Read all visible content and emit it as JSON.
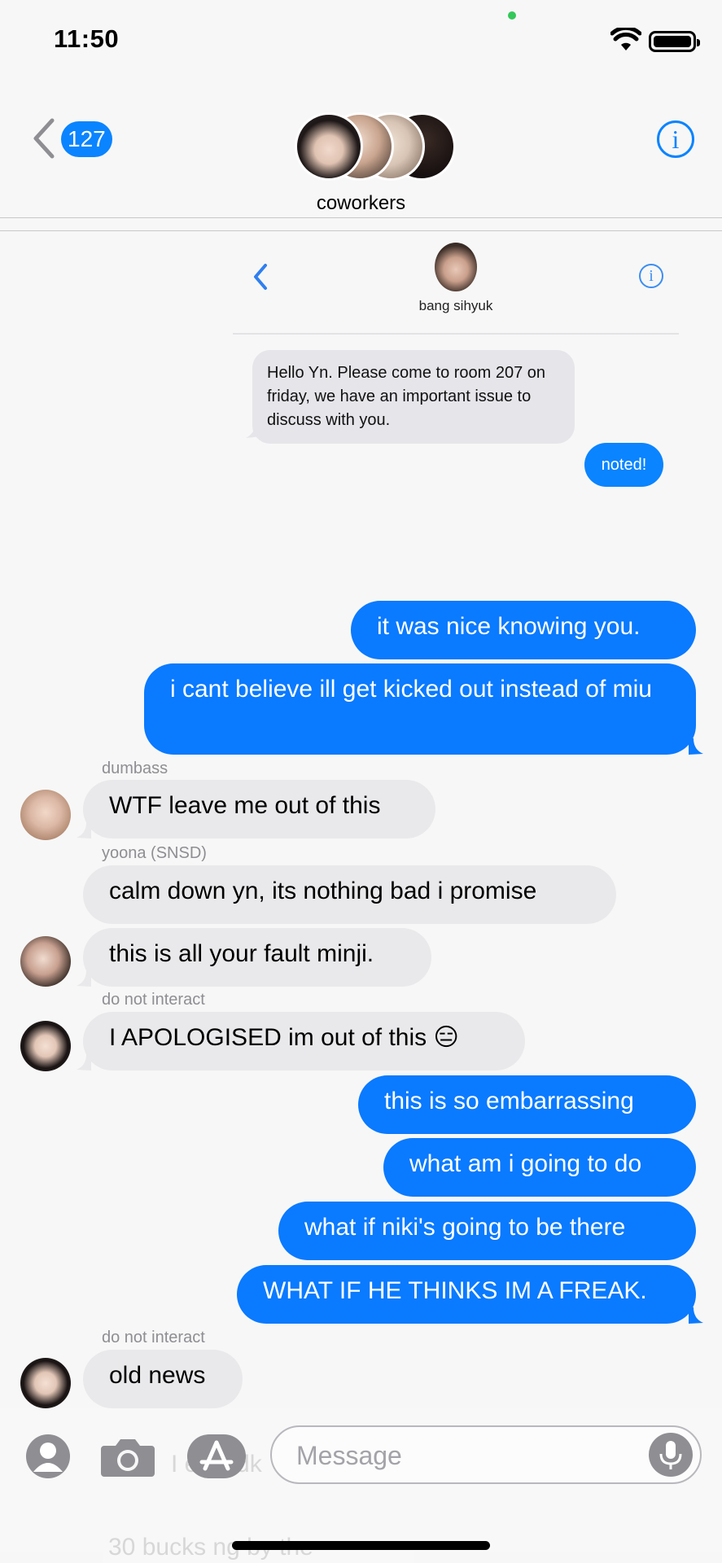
{
  "status_bar": {
    "time": "11:50"
  },
  "header": {
    "back_badge": "127",
    "group_name": "coworkers",
    "info_label": "i"
  },
  "embedded_screenshot": {
    "contact_name": "bang sihyuk",
    "info_label": "i",
    "received_message": "Hello Yn. Please come to room 207 on friday, we have an important issue to discuss with you.",
    "sent_message": "noted!"
  },
  "messages": [
    {
      "text": "it was nice knowing you."
    },
    {
      "text": "i cant believe ill get kicked out instead of miu"
    },
    {
      "sender": "dumbass",
      "text": "WTF leave me out of this"
    },
    {
      "sender": "yoona (SNSD)",
      "text": "calm down yn, its nothing bad i promise"
    },
    {
      "text": "this is all your fault minji."
    },
    {
      "sender": "do not interact",
      "text": "I APOLOGISED im out of this 😑"
    },
    {
      "text": "this is so embarrassing"
    },
    {
      "text": "what am i going to do"
    },
    {
      "text": "what if niki's going to be there"
    },
    {
      "text": "WHAT IF HE THINKS IM A FREAK."
    },
    {
      "sender": "do not interact",
      "text": "old news"
    }
  ],
  "composer": {
    "placeholder": "Message",
    "obscured_text_1": "I   e             id idk",
    "obscured_text_2": "30 bucks             ng by the"
  },
  "colors": {
    "accent": "#0a84ff",
    "sent_bubble": "#0a7aff",
    "received_bubble": "#e9e9eb",
    "background": "#f7f7f7"
  },
  "icons": [
    "back-chevron-icon",
    "info-icon",
    "wifi-icon",
    "battery-icon",
    "contact-icon",
    "camera-icon",
    "app-store-icon",
    "microphone-icon"
  ]
}
